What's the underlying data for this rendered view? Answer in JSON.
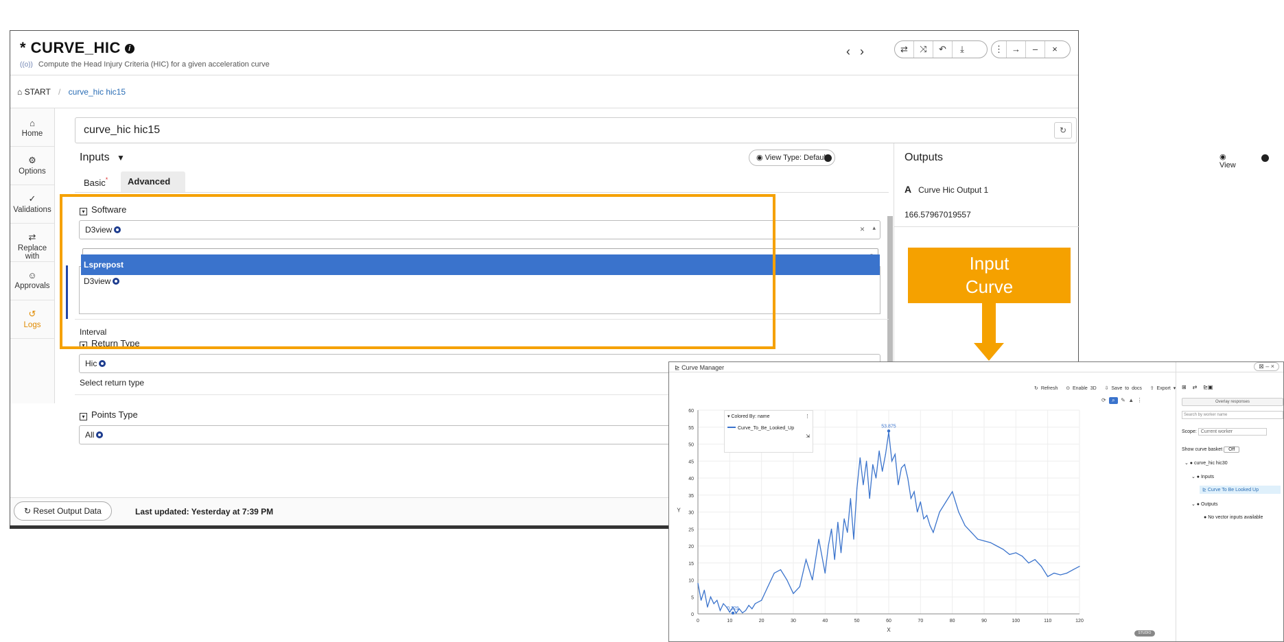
{
  "app": {
    "title": "* CURVE_HIC",
    "info_icon": "i",
    "signal_glyph": "((o))",
    "subtitle": "Compute the Head Injury Criteria (HIC) for a given acceleration curve",
    "nav": {
      "prev": "‹",
      "next": "›"
    },
    "toolbar_icons": [
      "swap-icon",
      "shuffle-icon",
      "undo-icon",
      "download-icon"
    ],
    "toolbar_glyphs": [
      "⇄",
      "⤨",
      "↶",
      "⤓"
    ],
    "window_glyphs": [
      "⋮",
      "→",
      "–",
      "×"
    ]
  },
  "breadcrumb": {
    "home_icon": "⌂",
    "start": "START",
    "separator": "/",
    "current": "curve_hic hic15"
  },
  "sidebar": {
    "items": [
      {
        "label": "Home",
        "icon": "⌂"
      },
      {
        "label": "Options",
        "icon": "⚙"
      },
      {
        "label": "Validations",
        "icon": "✓"
      },
      {
        "label": "Replace with",
        "icon": "⇄"
      },
      {
        "label": "Approvals",
        "icon": "☺"
      },
      {
        "label": "Logs",
        "icon": "↺"
      }
    ]
  },
  "name_field": {
    "value": "curve_hic hic15",
    "refresh_icon": "↻"
  },
  "inputs": {
    "header": "Inputs",
    "filter_glyph": "▼",
    "view_type_button": "View Type: Default",
    "eye_glyph": "◉",
    "tabs": [
      {
        "label": "Basic",
        "required_mark": "*"
      },
      {
        "label": "Advanced"
      }
    ],
    "software": {
      "title": "Software",
      "selected": "D3view",
      "clear_glyph": "×",
      "caret_glyph": "▴",
      "search_placeholder": "",
      "search_icon": "⌕",
      "options": [
        "Lsprepost",
        "D3view"
      ]
    },
    "interval_label": "Interval",
    "return_type": {
      "title": "Return Type",
      "selected": "Hic",
      "help": "Select return type"
    },
    "points_type": {
      "title": "Points Type",
      "selected": "All"
    },
    "collapse_glyph": "▾"
  },
  "outputs": {
    "header": "Outputs",
    "view_button": "View",
    "item_glyph": "A",
    "item_label": "Curve Hic Output 1",
    "value": "166.57967019557"
  },
  "footer": {
    "reset_button": "Reset Output Data",
    "reset_icon": "↻",
    "last_updated": "Last updated: Yesterday at 7:39 PM"
  },
  "callout": {
    "line1": "Input",
    "line2": "Curve"
  },
  "curve_manager": {
    "title": "Curve Manager",
    "title_icon": "📈",
    "window_controls": "⊠ – ×",
    "toolbar": [
      "Refresh",
      "Enable 3D",
      "Save to docs",
      "Export ▾"
    ],
    "toolbar_icons": [
      "↻",
      "⊙",
      "⇩",
      "⇧"
    ],
    "plot_icons": [
      "⟳",
      "⌕",
      "✎",
      "▲",
      "⋮"
    ],
    "legend": {
      "title": "Colored By: name",
      "series": "Curve_To_Be_Looked_Up",
      "more_glyph": "⋮",
      "resize_glyph": "⇲"
    },
    "right_panel": {
      "tab_icons": [
        "⊞",
        "⇄",
        "📈"
      ],
      "overlay_button": "Overlay responses",
      "search_placeholder": "Search by worker name",
      "scope_label": "Scope:",
      "scope_value": "Current worker",
      "show_basket_label": "Show curve basket",
      "show_basket_value": "Off",
      "tree": {
        "root": "curve_hic hic30",
        "inputs": "Inputs",
        "input_item": "Curve To Be Looked Up",
        "outputs": "Outputs",
        "outputs_empty": "No vector inputs available"
      }
    },
    "badge": "STUDIO"
  },
  "chart_data": {
    "type": "line",
    "xlabel": "X",
    "ylabel": "Y",
    "xlim": [
      0,
      120
    ],
    "ylim": [
      0,
      60
    ],
    "x_ticks": [
      0,
      10,
      20,
      30,
      40,
      50,
      60,
      70,
      80,
      90,
      100,
      110,
      120
    ],
    "y_ticks": [
      0,
      5,
      10,
      15,
      20,
      25,
      30,
      35,
      40,
      45,
      50,
      55,
      60
    ],
    "grid": true,
    "legend_position": "top-left",
    "series": [
      {
        "name": "Curve_To_Be_Looked_Up",
        "color": "#3a73cc",
        "x": [
          0,
          1,
          2,
          3,
          4,
          5,
          6,
          7,
          8,
          9,
          10,
          11,
          12,
          13,
          14,
          15,
          16,
          17,
          18,
          20,
          22,
          24,
          26,
          28,
          30,
          32,
          34,
          36,
          38,
          40,
          41,
          42,
          43,
          44,
          45,
          46,
          47,
          48,
          49,
          50,
          51,
          52,
          53,
          54,
          55,
          56,
          57,
          58,
          59,
          60,
          61,
          62,
          63,
          64,
          65,
          66,
          67,
          68,
          69,
          70,
          71,
          72,
          73,
          74,
          75,
          76,
          78,
          80,
          82,
          84,
          86,
          88,
          90,
          92,
          94,
          96,
          98,
          100,
          102,
          104,
          106,
          108,
          110,
          112,
          114,
          116,
          118,
          120
        ],
        "y": [
          9,
          4,
          7,
          2,
          5,
          3,
          4,
          1,
          3,
          2,
          0.5,
          2,
          0.2,
          1.5,
          0.3,
          1,
          2.5,
          1.5,
          3,
          4,
          8,
          12,
          13,
          10,
          6,
          8,
          16,
          10,
          22,
          12,
          20,
          25,
          16,
          27,
          18,
          28,
          24,
          34,
          22,
          37,
          46,
          38,
          45,
          34,
          44,
          40,
          48,
          42,
          47,
          53.5,
          45,
          47,
          38,
          43,
          44,
          40,
          34,
          36,
          30,
          33,
          28,
          29,
          26,
          24,
          27,
          30,
          33,
          36,
          30,
          26,
          24,
          22,
          21.5,
          21,
          20,
          19,
          17.5,
          18,
          17,
          15,
          16,
          14,
          11,
          12,
          11.5,
          12,
          13,
          14
        ]
      }
    ],
    "annotations": [
      {
        "text": "53.875",
        "x": 60,
        "y": 53.875
      },
      {
        "text": "0.229",
        "x": 11,
        "y": 0.229
      }
    ]
  }
}
